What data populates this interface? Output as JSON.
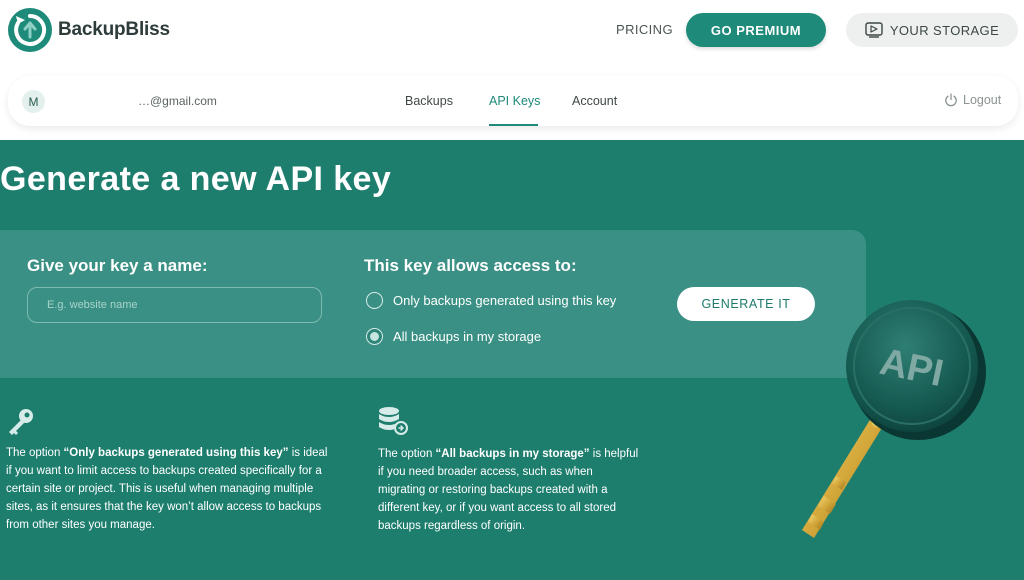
{
  "brand": {
    "name": "BackupBliss"
  },
  "header": {
    "pricing_label": "PRICING",
    "premium_label": "GO PREMIUM",
    "storage_label": "YOUR STORAGE"
  },
  "account_bar": {
    "avatar_initial": "M",
    "email": "…@gmail.com",
    "tabs": [
      {
        "label": "Backups",
        "active": false
      },
      {
        "label": "API Keys",
        "active": true
      },
      {
        "label": "Account",
        "active": false
      }
    ],
    "logout_label": "Logout"
  },
  "page": {
    "title": "Generate a new API key"
  },
  "form": {
    "name_label": "Give your key a name:",
    "name_placeholder": "E.g. website name",
    "name_value": "",
    "access_label": "This key allows access to:",
    "options": [
      {
        "label": "Only backups generated using this key",
        "checked": false
      },
      {
        "label": "All backups in my storage",
        "checked": true
      }
    ],
    "generate_label": "GENERATE IT"
  },
  "info": {
    "left": {
      "prefix": "The option ",
      "highlight": "“Only backups generated using this key”",
      "suffix": " is ideal if you want to limit access to backups created specifically for a certain site or project. This is useful when managing multiple sites, as it ensures that the key won’t allow access to backups from other sites you manage."
    },
    "right": {
      "prefix": "The option ",
      "highlight": "“All backups in my storage”",
      "suffix": " is helpful if you need broader access, such as when migrating or restoring backups created with a different key, or if you want access to all stored backups regardless of origin."
    }
  },
  "illustration": {
    "key_label": "API"
  },
  "colors": {
    "brand_teal": "#1d8a7a",
    "page_background": "#1e7e6e",
    "card_background": "#3a9084",
    "key_gold": "#d4a83a"
  },
  "icons": [
    "logo-mark-icon",
    "storage-icon",
    "power-icon",
    "key-icon",
    "database-icon"
  ]
}
